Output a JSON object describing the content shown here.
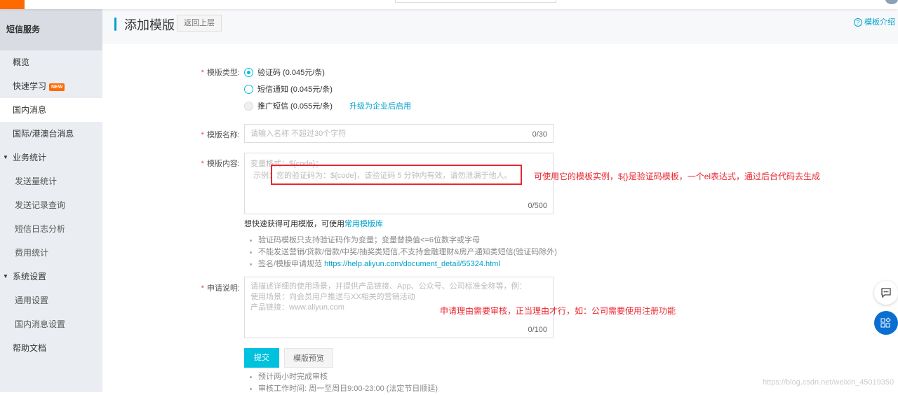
{
  "sidebar": {
    "header": "短信服务",
    "items": [
      {
        "label": "概览"
      },
      {
        "label": "快速学习",
        "badge": "NEW"
      },
      {
        "label": "国内消息",
        "selected": true
      },
      {
        "label": "国际/港澳台消息"
      },
      {
        "label": "业务统计",
        "group": true
      },
      {
        "label": "发送量统计"
      },
      {
        "label": "发送记录查询"
      },
      {
        "label": "短信日志分析"
      },
      {
        "label": "费用统计"
      },
      {
        "label": "系统设置",
        "group": true
      },
      {
        "label": "通用设置"
      },
      {
        "label": "国内消息设置"
      },
      {
        "label": "帮助文档"
      }
    ]
  },
  "header": {
    "title": "添加模版",
    "back_label": "返回上层",
    "intro_label": "模板介绍"
  },
  "form": {
    "type_label": "模版类型:",
    "types": [
      {
        "label": "验证码 (0.045元/条)",
        "checked": true
      },
      {
        "label": "短信通知 (0.045元/条)"
      },
      {
        "label": "推广短信 (0.055元/条)",
        "disabled": true
      }
    ],
    "upgrade_link": "升级为企业后启用",
    "name_label": "模版名称:",
    "name_placeholder": "请输入名称 不超过30个字符",
    "name_count": "0/30",
    "content_label": "模版内容:",
    "content_placeholder_1": "变量格式：${code}；",
    "content_placeholder_2": "示例：您的验证码为：${code}，该验证码 5 分钟内有效，请勿泄漏于他人。",
    "content_count": "0/500",
    "library_hint": "想快速获得可用模版，可使用",
    "library_link": "常用模版库",
    "rules": [
      "验证码模板只支持验证码作为变量；变量替换值<=6位数字或字母",
      "不能发送营销/贷款/借款/中奖/抽奖类短信,不支持金融理财&房产通知类短信(验证码除外)"
    ],
    "rule_spec": "签名/模版申请规范 ",
    "rule_spec_link": "https://help.aliyun.com/document_detail/55324.html",
    "reason_label": "申请说明:",
    "reason_placeholder_1": "请描述详细的使用场景，并提供产品链接、App、公众号、公司标准全称等，例：",
    "reason_placeholder_2": "使用场景：向会员用户推送与XX相关的营销活动",
    "reason_placeholder_3": "产品链接：www.aliyun.com",
    "reason_count": "0/100",
    "submit_label": "提交",
    "preview_label": "模版预览",
    "notes": [
      "预计两小时完成审核",
      "审核工作时间: 周一至周日9:00-23:00  (法定节日顺延)"
    ]
  },
  "annotations": {
    "content_note": "可使用它的模板实例，${}是验证码模板，一个el表达式，通过后台代码去生成",
    "reason_note": "申请理由需要审核，正当理由才行，如：公司需要使用注册功能"
  },
  "watermark": "https://blog.csdn.net/weixin_45019350",
  "colors": {
    "accent": "#00c1de",
    "brand": "#ff6a00",
    "annotation": "#e8262f",
    "fab": "#0a6fd1"
  }
}
